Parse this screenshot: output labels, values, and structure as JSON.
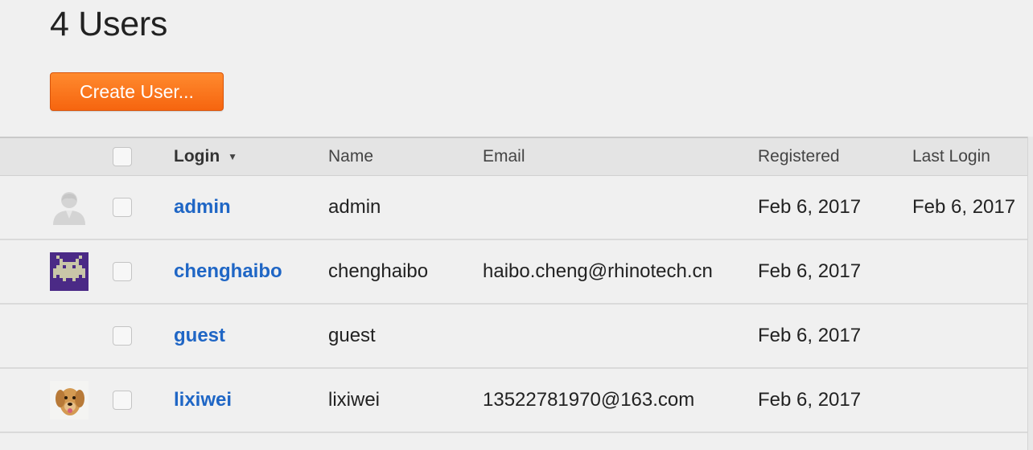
{
  "header": {
    "title": "4 Users",
    "create_button_label": "Create User..."
  },
  "table": {
    "columns": {
      "login": "Login",
      "name": "Name",
      "email": "Email",
      "registered": "Registered",
      "last_login": "Last Login"
    },
    "rows": [
      {
        "avatar": "default-user-icon",
        "login": "admin",
        "name": "admin",
        "email": "",
        "registered": "Feb 6, 2017",
        "last_login": "Feb 6, 2017"
      },
      {
        "avatar": "pixel-robot-avatar",
        "login": "chenghaibo",
        "name": "chenghaibo",
        "email": "haibo.cheng@rhinotech.cn",
        "registered": "Feb 6, 2017",
        "last_login": ""
      },
      {
        "avatar": "",
        "login": "guest",
        "name": "guest",
        "email": "",
        "registered": "Feb 6, 2017",
        "last_login": ""
      },
      {
        "avatar": "dog-photo-avatar",
        "login": "lixiwei",
        "name": "lixiwei",
        "email": "13522781970@163.com",
        "registered": "Feb 6, 2017",
        "last_login": ""
      }
    ]
  },
  "colors": {
    "accent": "#f6650f",
    "link": "#1f66c5",
    "background": "#f0f0f0",
    "header_bg": "#e4e4e4"
  }
}
